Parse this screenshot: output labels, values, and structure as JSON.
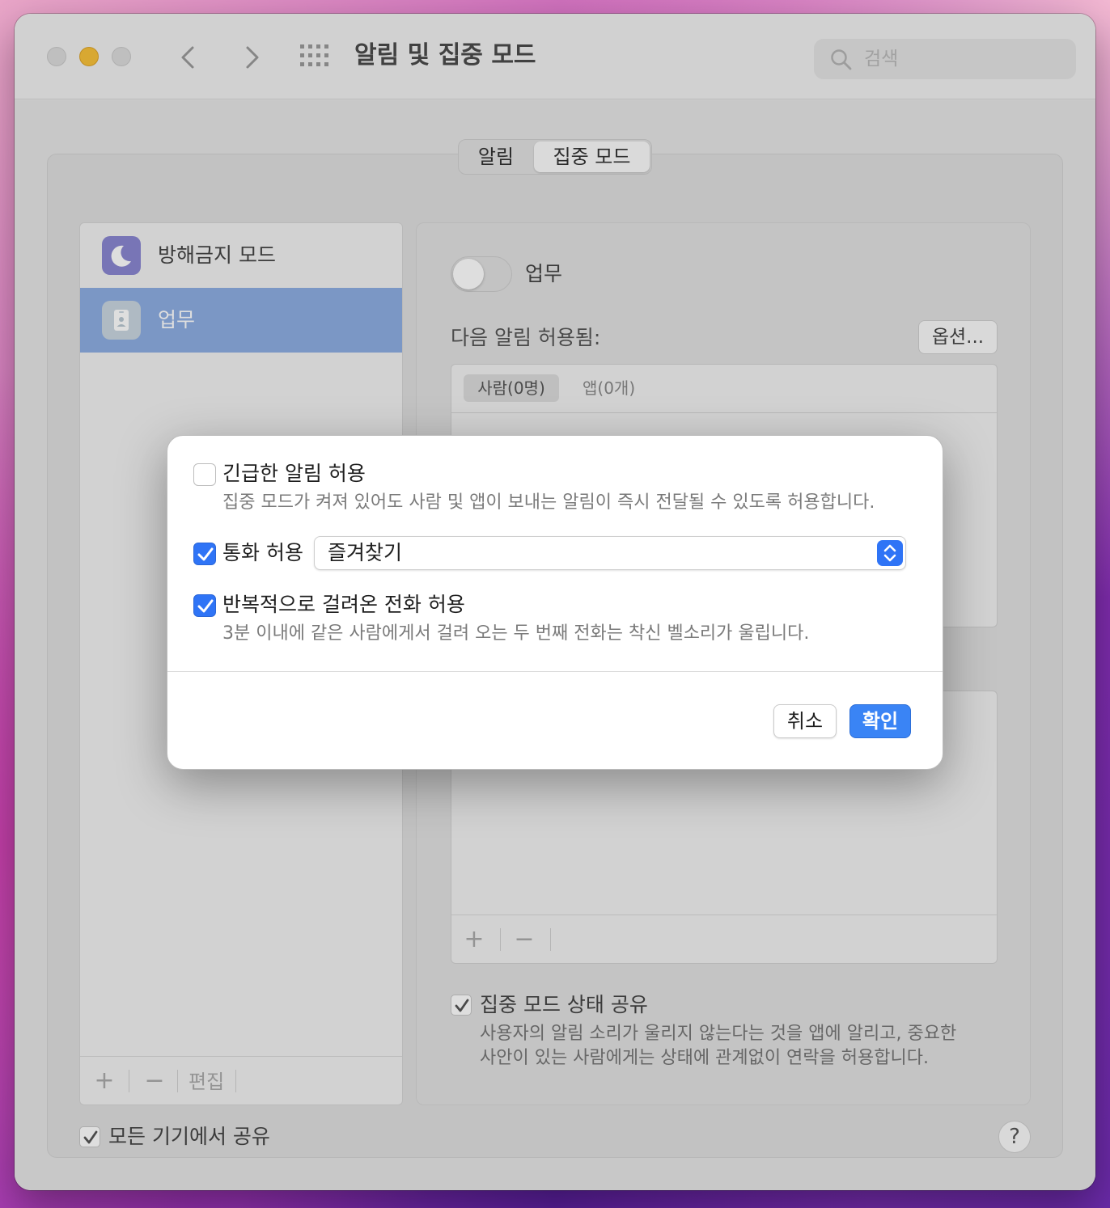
{
  "window": {
    "title": "알림 및 집중 모드",
    "search_placeholder": "검색"
  },
  "tabs": [
    {
      "label": "알림",
      "selected": false
    },
    {
      "label": "집중 모드",
      "selected": true
    }
  ],
  "sidebar": {
    "items": [
      {
        "label": "방해금지 모드",
        "icon": "moon-icon",
        "selected": false
      },
      {
        "label": "업무",
        "icon": "badge-icon",
        "selected": true
      }
    ],
    "footer": {
      "add": "+",
      "remove": "−",
      "edit": "편집"
    }
  },
  "panel": {
    "toggle_label": "업무",
    "toggle_on": false,
    "allowed_label": "다음 알림 허용됨:",
    "options_button": "옵션...",
    "list_tabs": [
      {
        "label": "사람(0명)",
        "selected": true
      },
      {
        "label": "앱(0개)",
        "selected": false
      }
    ],
    "list2_footer": {
      "add": "+",
      "remove": "−"
    },
    "share_status": {
      "checked": true,
      "label": "집중 모드 상태 공유",
      "desc_line1": "사용자의 알림 소리가 울리지 않는다는 것을 앱에 알리고, 중요한",
      "desc_line2": "사안이 있는 사람에게는 상태에 관계없이 연락을 허용합니다."
    }
  },
  "share_across_devices": {
    "checked": true,
    "label": "모든 기기에서 공유"
  },
  "help": "?",
  "dialog": {
    "time_sensitive": {
      "checked": false,
      "label": "긴급한 알림 허용",
      "desc": "집중 모드가 켜져 있어도 사람 및 앱이 보내는 알림이 즉시 전달될 수 있도록 허용합니다."
    },
    "allow_calls": {
      "checked": true,
      "label": "통화 허용",
      "selected_option": "즐겨찾기"
    },
    "repeated_calls": {
      "checked": true,
      "label": "반복적으로 걸려온 전화 허용",
      "desc": "3분 이내에 같은 사람에게서 걸려 오는 두 번째 전화는 착신 벨소리가 울립니다."
    },
    "cancel_button": "취소",
    "ok_button": "확인"
  },
  "colors": {
    "accent": "#2f74f6",
    "selected_row": "#8eaee3",
    "traffic_min": "#f8c13a"
  }
}
